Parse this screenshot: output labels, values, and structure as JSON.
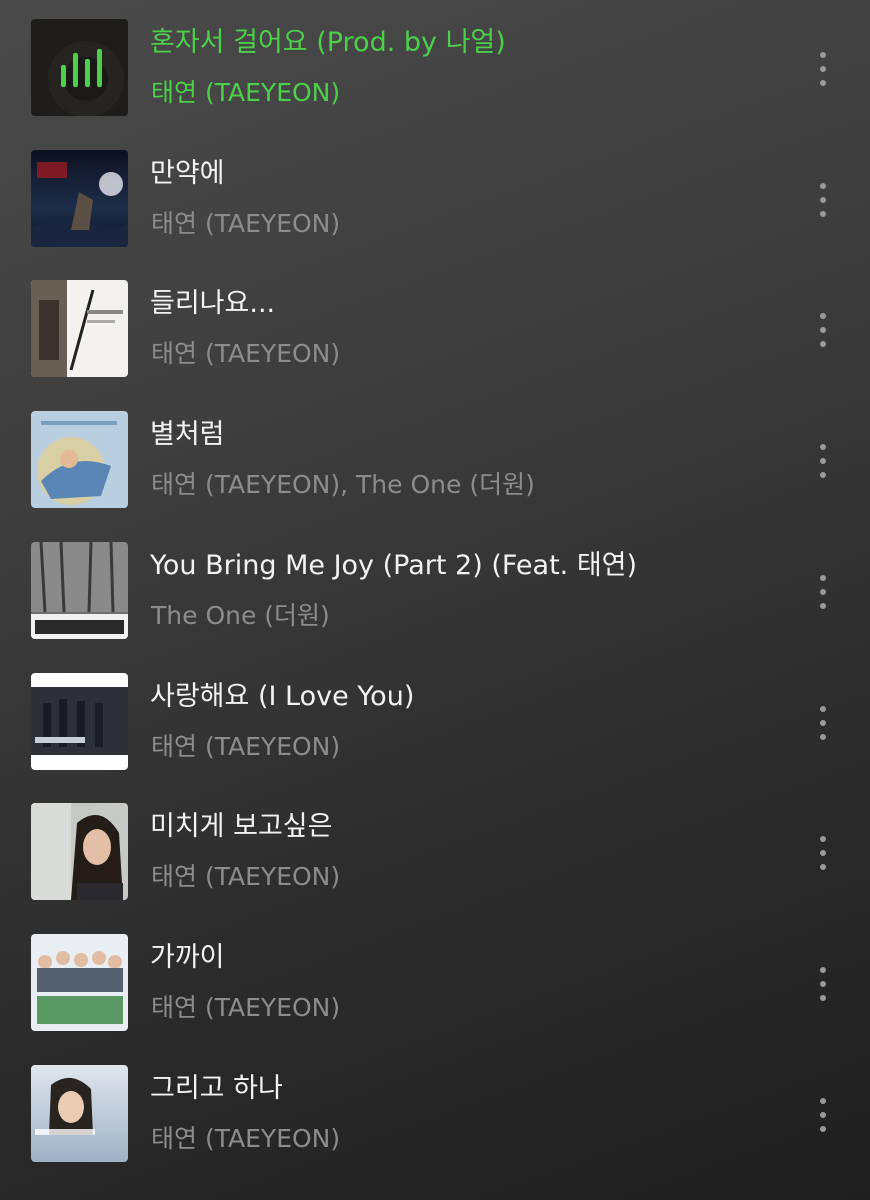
{
  "accent_color": "#4cd04a",
  "songs": [
    {
      "title": "혼자서 걸어요 (Prod. by 나얼)",
      "artist": "태연 (TAEYEON)",
      "playing": true
    },
    {
      "title": "만약에",
      "artist": "태연 (TAEYEON)",
      "playing": false
    },
    {
      "title": "들리나요...",
      "artist": "태연 (TAEYEON)",
      "playing": false
    },
    {
      "title": "별처럼",
      "artist": "태연 (TAEYEON), The One (더원)",
      "playing": false
    },
    {
      "title": "You Bring Me Joy (Part 2) (Feat. 태연)",
      "artist": "The One (더원)",
      "playing": false
    },
    {
      "title": "사랑해요 (I Love You)",
      "artist": "태연 (TAEYEON)",
      "playing": false
    },
    {
      "title": "미치게 보고싶은",
      "artist": "태연 (TAEYEON)",
      "playing": false
    },
    {
      "title": "가까이",
      "artist": "태연 (TAEYEON)",
      "playing": false
    },
    {
      "title": "그리고 하나",
      "artist": "태연 (TAEYEON)",
      "playing": false
    }
  ],
  "icons": {
    "now_playing": "equalizer-icon",
    "more": "more-vertical-icon"
  }
}
